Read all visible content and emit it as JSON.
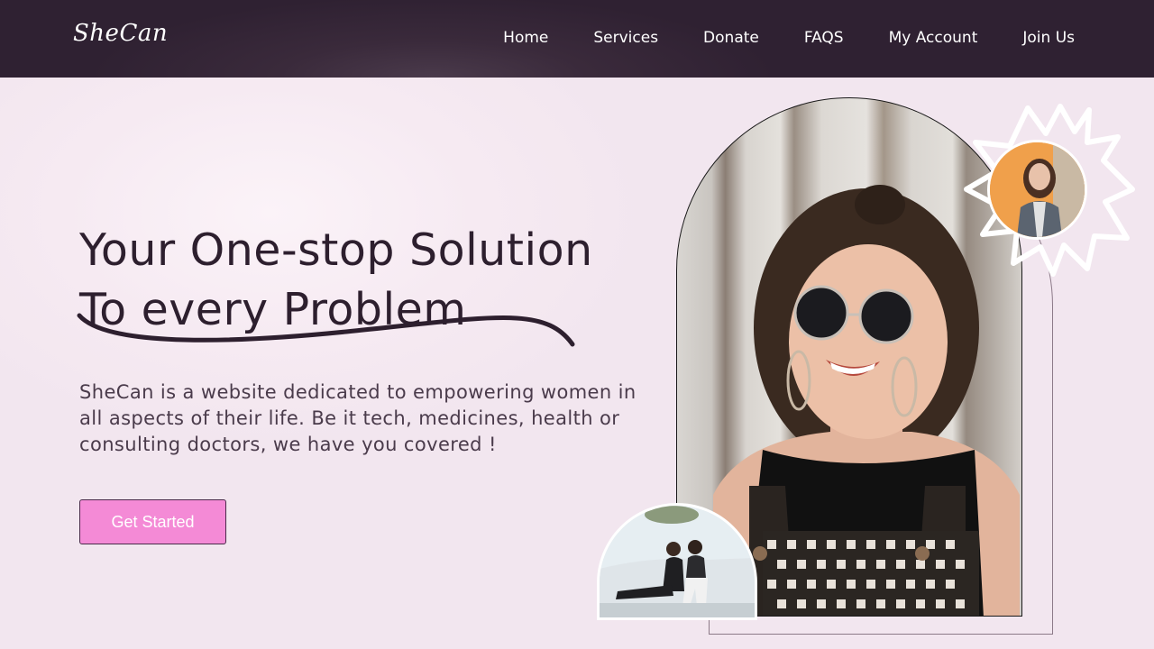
{
  "nav": {
    "logo": "SheCan",
    "links": [
      "Home",
      "Services",
      "Donate",
      "FAQS",
      "My Account",
      "Join Us"
    ]
  },
  "hero": {
    "title_line1": "Your One-stop Solution",
    "title_line2": "To every Problem",
    "description": "SheCan is a website dedicated to empowering women in all aspects of their life. Be it tech, medicines, health or consulting doctors, we have you covered !",
    "cta_label": "Get Started"
  },
  "colors": {
    "nav_bg": "#2f2132",
    "page_bg": "#f3e7f0",
    "heading": "#2d1f2e",
    "button": "#f48ad6"
  }
}
